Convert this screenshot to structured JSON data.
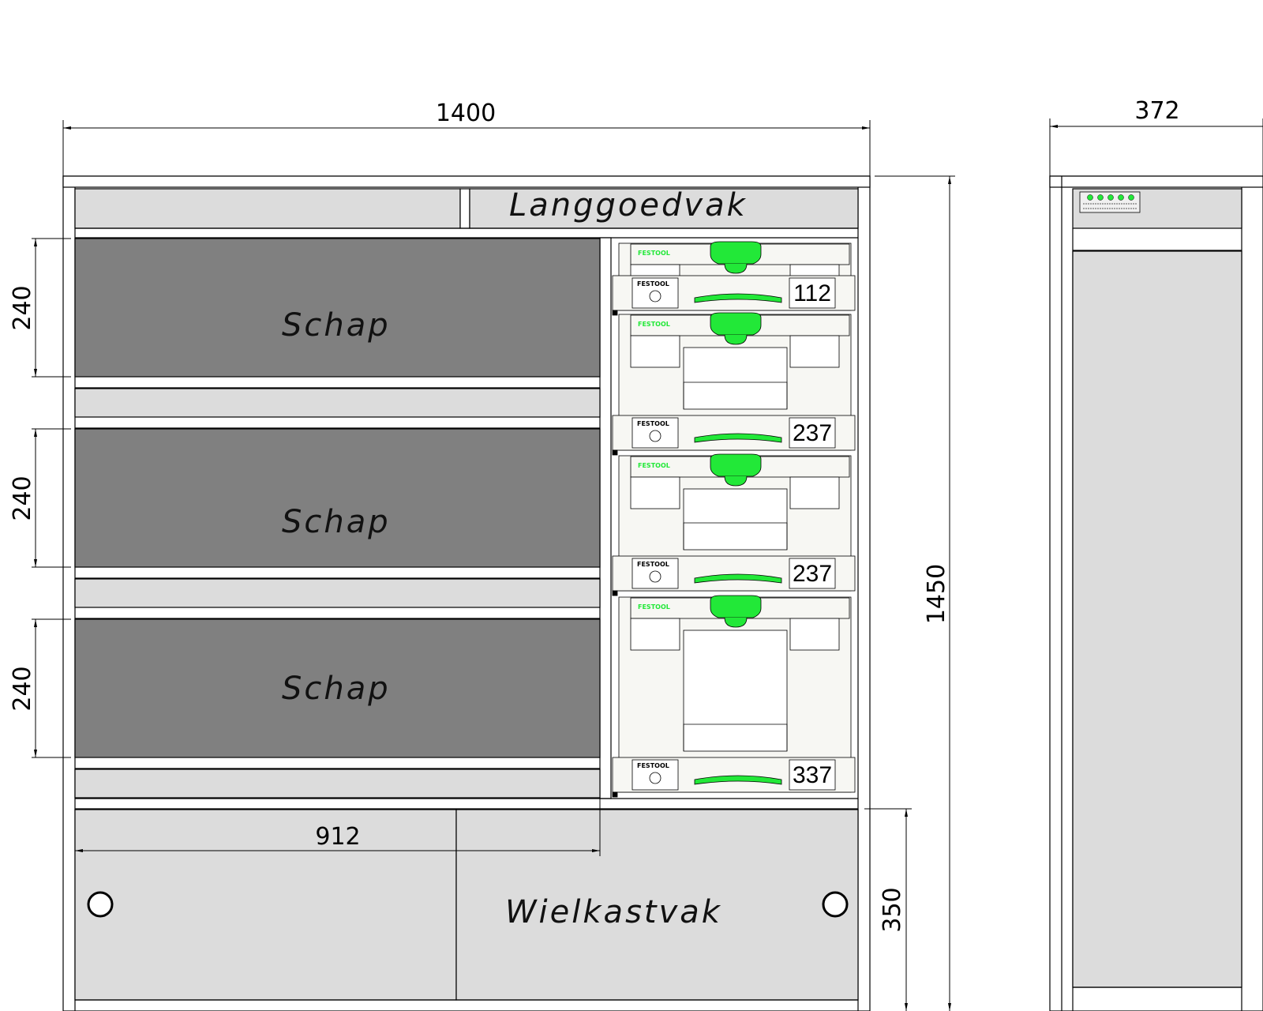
{
  "dimensions": {
    "width_front": "1400",
    "width_side": "372",
    "height_total": "1450",
    "height_wheel": "350",
    "width_partition": "912",
    "shelf_heights": [
      "240",
      "240",
      "240"
    ]
  },
  "labels": {
    "top_compartment": "Langgoedvak",
    "shelves": [
      "Schap",
      "Schap",
      "Schap"
    ],
    "bottom_compartment": "Wielkastvak"
  },
  "systainers": [
    {
      "brand": "FESTOOL",
      "size": "112"
    },
    {
      "brand": "FESTOOL",
      "size": "237"
    },
    {
      "brand": "FESTOOL",
      "size": "237"
    },
    {
      "brand": "FESTOOL",
      "size": "337"
    }
  ],
  "colors": {
    "panel_light": "#dcdcdc",
    "shelf_dark": "#808080",
    "systainer_body": "#f7f7f3",
    "festool_green": "#22e838",
    "line": "#000000"
  }
}
